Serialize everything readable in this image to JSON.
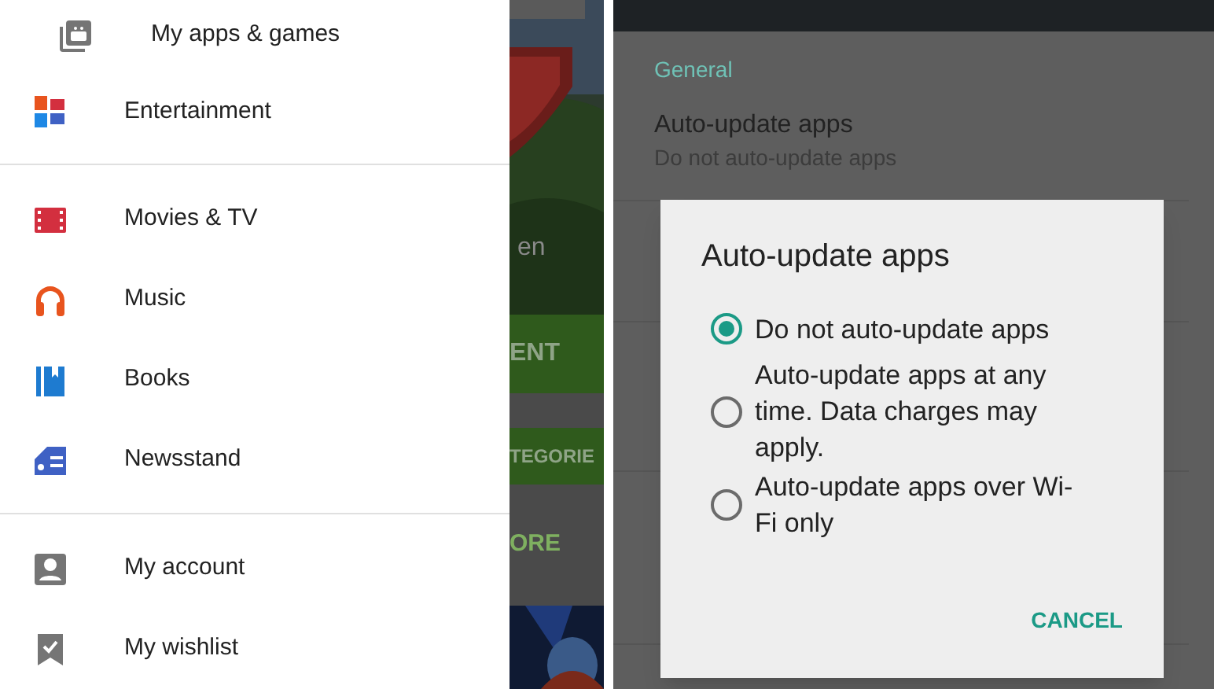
{
  "drawer": {
    "header": {
      "label": "My apps & games"
    },
    "sections": [
      [
        {
          "label": "Entertainment"
        }
      ],
      [
        {
          "label": "Movies & TV"
        },
        {
          "label": "Music"
        },
        {
          "label": "Books"
        },
        {
          "label": "Newsstand"
        }
      ],
      [
        {
          "label": "My account"
        },
        {
          "label": "My wishlist"
        }
      ]
    ]
  },
  "store_background": {
    "texts": [
      "en",
      "ENT",
      "TEGORIE",
      "ORE"
    ]
  },
  "settings": {
    "section": "General",
    "rows": [
      {
        "title": "Auto-update apps",
        "subtitle": "Do not auto-update apps"
      }
    ]
  },
  "dialog": {
    "title": "Auto-update apps",
    "options": [
      {
        "label": "Do not auto-update apps",
        "selected": true
      },
      {
        "label": "Auto-update apps at any time. Data charges may apply.",
        "selected": false
      },
      {
        "label": "Auto-update apps over Wi-Fi only",
        "selected": false
      }
    ],
    "buttons": [
      "CANCEL"
    ]
  }
}
